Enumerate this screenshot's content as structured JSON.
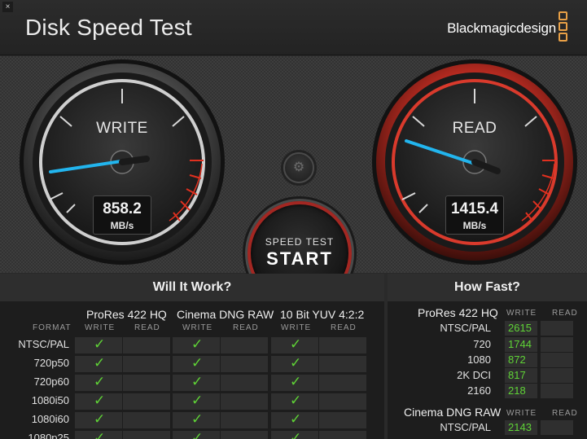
{
  "window": {
    "close_glyph": "×"
  },
  "header": {
    "title": "Disk Speed Test",
    "brand": "Blackmagicdesign",
    "brand_color": "#e8a046"
  },
  "write_gauge": {
    "label": "WRITE",
    "value": "858.2",
    "unit": "MB/s"
  },
  "read_gauge": {
    "label": "READ",
    "value": "1415.4",
    "unit": "MB/s"
  },
  "settings": {
    "icon": "gear-icon",
    "glyph": "⚙"
  },
  "start_button": {
    "small": "SPEED TEST",
    "big": "START",
    "ring_color": "#a32722"
  },
  "will_it_work": {
    "title": "Will It Work?",
    "format_label": "FORMAT",
    "formats": [
      "ProRes 422 HQ",
      "Cinema DNG RAW",
      "10 Bit YUV 4:2:2"
    ],
    "write_label": "WRITE",
    "read_label": "READ",
    "check_glyph": "✓",
    "rows": [
      "NTSC/PAL",
      "720p50",
      "720p60",
      "1080i50",
      "1080i60",
      "1080p25"
    ]
  },
  "how_fast": {
    "title": "How Fast?",
    "write_label": "WRITE",
    "read_label": "READ",
    "sections": [
      {
        "name": "ProRes 422 HQ",
        "rows": [
          {
            "label": "NTSC/PAL",
            "write": "2615"
          },
          {
            "label": "720",
            "write": "1744"
          },
          {
            "label": "1080",
            "write": "872"
          },
          {
            "label": "2K DCI",
            "write": "817"
          },
          {
            "label": "2160",
            "write": "218"
          }
        ]
      },
      {
        "name": "Cinema DNG RAW",
        "rows": [
          {
            "label": "NTSC/PAL",
            "write": "2143"
          }
        ]
      }
    ]
  }
}
